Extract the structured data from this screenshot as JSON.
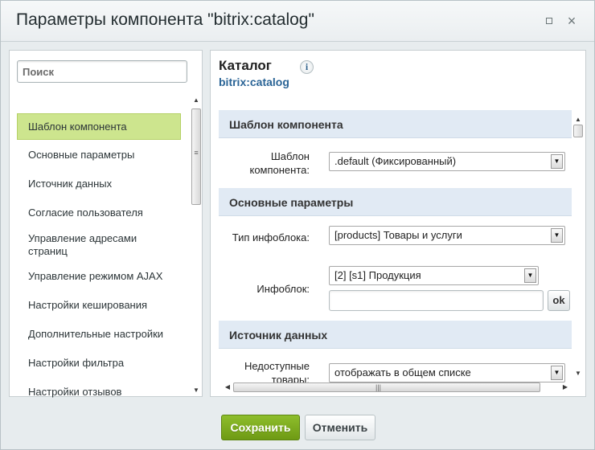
{
  "window": {
    "title": "Параметры компонента \"bitrix:catalog\"",
    "maximize_icon": "maximize-icon",
    "close_glyph": "×"
  },
  "sidebar": {
    "search_placeholder": "Поиск",
    "items": [
      {
        "label": "Шаблон компонента",
        "active": true
      },
      {
        "label": "Основные параметры"
      },
      {
        "label": "Источник данных"
      },
      {
        "label": "Согласие пользователя"
      },
      {
        "label": "Управление адресами страниц"
      },
      {
        "label": "Управление режимом AJAX"
      },
      {
        "label": "Настройки кеширования"
      },
      {
        "label": "Дополнительные настройки"
      },
      {
        "label": "Настройки фильтра"
      },
      {
        "label": "Настройки отзывов"
      }
    ]
  },
  "component": {
    "name": "Каталог",
    "code": "bitrix:catalog",
    "info_glyph": "i"
  },
  "sections": [
    {
      "header": "Шаблон компонента",
      "params": [
        {
          "label": "Шаблон компонента:",
          "value": ".default (Фиксированный)"
        }
      ]
    },
    {
      "header": "Основные параметры",
      "params": [
        {
          "label": "Тип инфоблока:",
          "value": "[products] Товары и услуги"
        },
        {
          "label": "Инфоблок:",
          "value": "[2] [s1] Продукция",
          "extra_input_value": "",
          "extra_button": "ok"
        }
      ]
    },
    {
      "header": "Источник данных",
      "params": [
        {
          "label": "Недоступные товары:",
          "value": "отображать в общем списке"
        }
      ]
    }
  ],
  "footer": {
    "save_label": "Сохранить",
    "cancel_label": "Отменить"
  },
  "colors": {
    "active_item": "#cde58e",
    "section_header": "#e1eaf4",
    "save_button": "#7aa81f",
    "link": "#2a6496"
  }
}
